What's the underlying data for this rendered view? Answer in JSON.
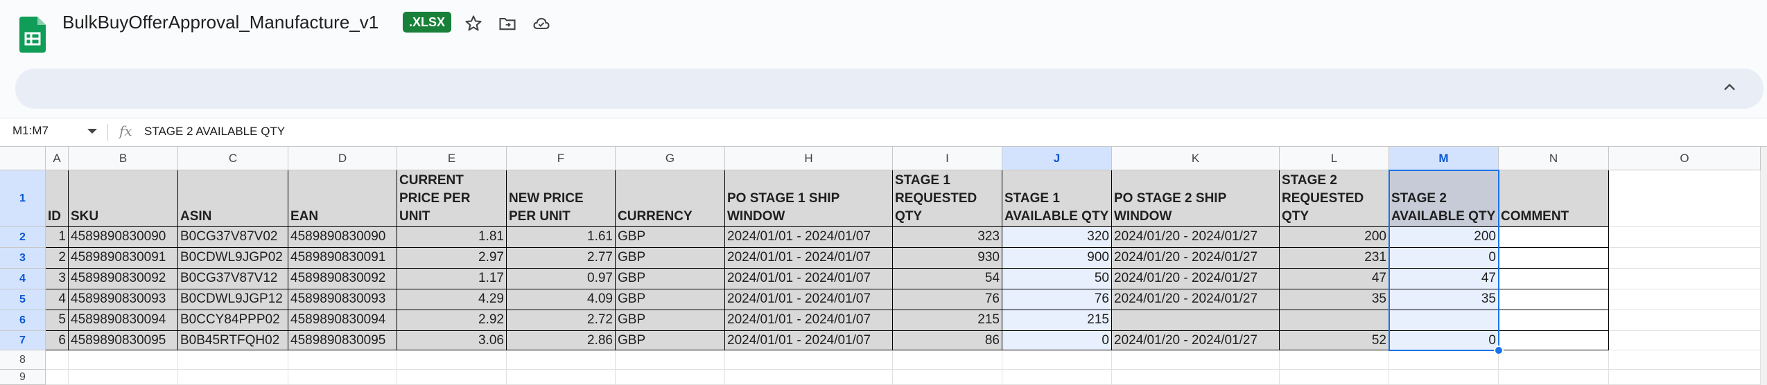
{
  "doc": {
    "title": "BulkBuyOfferApproval_Manufacture_v1",
    "badge": ".XLSX",
    "icons": [
      "star-icon",
      "move-to-folder-icon",
      "cloud-saved-icon"
    ]
  },
  "colors": {
    "brand_green": "#188038",
    "selection_blue": "#1a73e8",
    "header_gray": "#d9d9d9"
  },
  "formula_bar": {
    "name_box": "M1:M7",
    "fx": "fx",
    "content": "STAGE 2 AVAILABLE QTY"
  },
  "columns": [
    "A",
    "B",
    "C",
    "D",
    "E",
    "F",
    "G",
    "H",
    "I",
    "J",
    "K",
    "L",
    "M",
    "N",
    "O"
  ],
  "rows": [
    "1",
    "2",
    "3",
    "4",
    "5",
    "6",
    "7",
    "8",
    "9"
  ],
  "headers": {
    "A": "ID",
    "B": "SKU",
    "C": "ASIN",
    "D": "EAN",
    "E": "CURRENT PRICE PER UNIT",
    "F": "NEW PRICE PER UNIT",
    "G": "CURRENCY",
    "H": "PO STAGE 1 SHIP WINDOW",
    "I": "STAGE 1 REQUESTED QTY",
    "J": "STAGE 1 AVAILABLE QTY",
    "K": "PO STAGE 2 SHIP WINDOW",
    "L": "STAGE 2 REQUESTED QTY",
    "M": "STAGE 2 AVAILABLE QTY",
    "N": "COMMENT"
  },
  "data": [
    [
      "1",
      "4589890830090",
      "B0CG37V87V02",
      "4589890830090",
      "1.81",
      "1.61",
      "GBP",
      "2024/01/01 - 2024/01/07",
      "323",
      "320",
      "2024/01/20 - 2024/01/27",
      "200",
      "200",
      ""
    ],
    [
      "2",
      "4589890830091",
      "B0CDWL9JGP02",
      "4589890830091",
      "2.97",
      "2.77",
      "GBP",
      "2024/01/01 - 2024/01/07",
      "930",
      "900",
      "2024/01/20 - 2024/01/27",
      "231",
      "0",
      ""
    ],
    [
      "3",
      "4589890830092",
      "B0CG37V87V12",
      "4589890830092",
      "1.17",
      "0.97",
      "GBP",
      "2024/01/01 - 2024/01/07",
      "54",
      "50",
      "2024/01/20 - 2024/01/27",
      "47",
      "47",
      ""
    ],
    [
      "4",
      "4589890830093",
      "B0CDWL9JGP12",
      "4589890830093",
      "4.29",
      "4.09",
      "GBP",
      "2024/01/01 - 2024/01/07",
      "76",
      "76",
      "2024/01/20 - 2024/01/27",
      "35",
      "35",
      ""
    ],
    [
      "5",
      "4589890830094",
      "B0CCY84PPP02",
      "4589890830094",
      "2.92",
      "2.72",
      "GBP",
      "2024/01/01 - 2024/01/07",
      "215",
      "215",
      "",
      "",
      "",
      ""
    ],
    [
      "6",
      "4589890830095",
      "B0B45RTFQH02",
      "4589890830095",
      "3.06",
      "2.86",
      "GBP",
      "2024/01/01 - 2024/01/07",
      "86",
      "0",
      "2024/01/20 - 2024/01/27",
      "52",
      "0",
      ""
    ]
  ]
}
